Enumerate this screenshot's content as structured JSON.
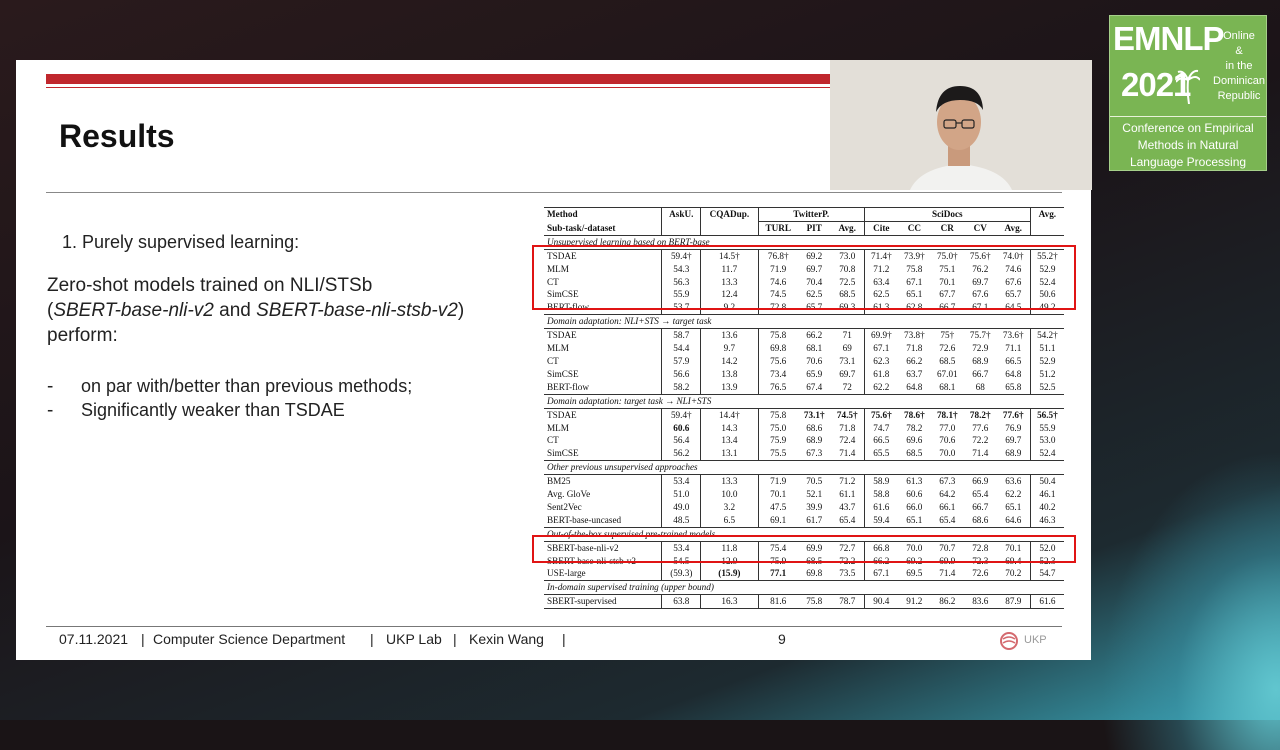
{
  "slide": {
    "title": "Results",
    "point_heading": "1. Purely supervised learning:",
    "line1": "Zero-shot models trained on NLI/STSb",
    "line2_paren_open": "(",
    "line2_model1": "SBERT-base-nli-v2",
    "line2_and": " and ",
    "line2_model2": "SBERT-base-nli-stsb-v2",
    "line2_paren_close": ")",
    "line3": "perform:",
    "bullets": [
      {
        "dash": "-",
        "text": "on par with/better than previous methods;"
      },
      {
        "dash": "-",
        "text": "Significantly weaker than TSDAE"
      }
    ],
    "footer": {
      "date": "07.11.2021",
      "sep": "|",
      "department": "Computer Science Department",
      "lab": "UKP Lab",
      "author": "Kexin Wang",
      "page": "9",
      "logo": "UKP"
    }
  },
  "table": {
    "head1": [
      "Method",
      "AskU.",
      "CQADup.",
      "TwitterP.",
      "SciDocs",
      "Avg."
    ],
    "head2": [
      "Sub-task/-dataset",
      "TURL",
      "PIT",
      "Avg.",
      "Cite",
      "CC",
      "CR",
      "CV",
      "Avg."
    ],
    "sections": [
      {
        "title": "Unsupervised learning based on BERT-base",
        "rows": [
          [
            "TSDAE",
            "59.4†",
            "14.5†",
            "76.8†",
            "69.2",
            "73.0",
            "71.4†",
            "73.9†",
            "75.0†",
            "75.6†",
            "74.0†",
            "55.2†"
          ],
          [
            "MLM",
            "54.3",
            "11.7",
            "71.9",
            "69.7",
            "70.8",
            "71.2",
            "75.8",
            "75.1",
            "76.2",
            "74.6",
            "52.9"
          ],
          [
            "CT",
            "56.3",
            "13.3",
            "74.6",
            "70.4",
            "72.5",
            "63.4",
            "67.1",
            "70.1",
            "69.7",
            "67.6",
            "52.4"
          ],
          [
            "SimCSE",
            "55.9",
            "12.4",
            "74.5",
            "62.5",
            "68.5",
            "62.5",
            "65.1",
            "67.7",
            "67.6",
            "65.7",
            "50.6"
          ],
          [
            "BERT-flow",
            "53.7",
            "9.2",
            "72.8",
            "65.7",
            "69.3",
            "61.3",
            "62.8",
            "66.7",
            "67.1",
            "64.5",
            "49.2"
          ]
        ]
      },
      {
        "title": "Domain adaptation: NLI+STS → target task",
        "rows": [
          [
            "TSDAE",
            "58.7",
            "13.6",
            "75.8",
            "66.2",
            "71",
            "69.9†",
            "73.8†",
            "75†",
            "75.7†",
            "73.6†",
            "54.2†"
          ],
          [
            "MLM",
            "54.4",
            "9.7",
            "69.8",
            "68.1",
            "69",
            "67.1",
            "71.8",
            "72.6",
            "72.9",
            "71.1",
            "51.1"
          ],
          [
            "CT",
            "57.9",
            "14.2",
            "75.6",
            "70.6",
            "73.1",
            "62.3",
            "66.2",
            "68.5",
            "68.9",
            "66.5",
            "52.9"
          ],
          [
            "SimCSE",
            "56.6",
            "13.8",
            "73.4",
            "65.9",
            "69.7",
            "61.8",
            "63.7",
            "67.01",
            "66.7",
            "64.8",
            "51.2"
          ],
          [
            "BERT-flow",
            "58.2",
            "13.9",
            "76.5",
            "67.4",
            "72",
            "62.2",
            "64.8",
            "68.1",
            "68",
            "65.8",
            "52.5"
          ]
        ]
      },
      {
        "title": "Domain adaptation: target task → NLI+STS",
        "rows": [
          [
            "TSDAE",
            "59.4†",
            "14.4†",
            "75.8",
            "73.1†",
            "74.5†",
            "75.6†",
            "78.6†",
            "78.1†",
            "78.2†",
            "77.6†",
            "56.5†"
          ],
          [
            "MLM",
            "60.6",
            "14.3",
            "75.0",
            "68.6",
            "71.8",
            "74.7",
            "78.2",
            "77.0",
            "77.6",
            "76.9",
            "55.9"
          ],
          [
            "CT",
            "56.4",
            "13.4",
            "75.9",
            "68.9",
            "72.4",
            "66.5",
            "69.6",
            "70.6",
            "72.2",
            "69.7",
            "53.0"
          ],
          [
            "SimCSE",
            "56.2",
            "13.1",
            "75.5",
            "67.3",
            "71.4",
            "65.5",
            "68.5",
            "70.0",
            "71.4",
            "68.9",
            "52.4"
          ]
        ]
      },
      {
        "title": "Other previous unsupervised approaches",
        "rows": [
          [
            "BM25",
            "53.4",
            "13.3",
            "71.9",
            "70.5",
            "71.2",
            "58.9",
            "61.3",
            "67.3",
            "66.9",
            "63.6",
            "50.4"
          ],
          [
            "Avg. GloVe",
            "51.0",
            "10.0",
            "70.1",
            "52.1",
            "61.1",
            "58.8",
            "60.6",
            "64.2",
            "65.4",
            "62.2",
            "46.1"
          ],
          [
            "Sent2Vec",
            "49.0",
            "3.2",
            "47.5",
            "39.9",
            "43.7",
            "61.6",
            "66.0",
            "66.1",
            "66.7",
            "65.1",
            "40.2"
          ],
          [
            "BERT-base-uncased",
            "48.5",
            "6.5",
            "69.1",
            "61.7",
            "65.4",
            "59.4",
            "65.1",
            "65.4",
            "68.6",
            "64.6",
            "46.3"
          ]
        ]
      },
      {
        "title": "Out-of-the-box supervised pre-trained models",
        "rows": [
          [
            "SBERT-base-nli-v2",
            "53.4",
            "11.8",
            "75.4",
            "69.9",
            "72.7",
            "66.8",
            "70.0",
            "70.7",
            "72.8",
            "70.1",
            "52.0"
          ],
          [
            "SBERT-base-nli-stsb-v2",
            "54.5",
            "12.9",
            "75.9",
            "68.5",
            "72.2",
            "66.2",
            "69.2",
            "69.9",
            "72.3",
            "69.4",
            "52.3"
          ],
          [
            "USE-large",
            "(59.3)",
            "(15.9)",
            "77.1",
            "69.8",
            "73.5",
            "67.1",
            "69.5",
            "71.4",
            "72.6",
            "70.2",
            "54.7"
          ]
        ]
      },
      {
        "title": "In-domain supervised training (upper bound)",
        "rows": [
          [
            "SBERT-supervised",
            "63.8",
            "16.3",
            "81.6",
            "75.8",
            "78.7",
            "90.4",
            "91.2",
            "86.2",
            "83.6",
            "87.9",
            "61.6"
          ]
        ]
      }
    ]
  },
  "badge": {
    "name": "EMNLP",
    "year": "2021",
    "location_lines": [
      "Online",
      "&",
      "in the",
      "Dominican",
      "Republic"
    ],
    "subtitle_lines": [
      "Conference on Empirical",
      "Methods in Natural",
      "Language Processing"
    ],
    "bg_color": "#7ab553"
  },
  "colors": {
    "accent_red": "#c0272d",
    "highlight_box": "#e01414"
  },
  "webcam": {
    "content": "presenter video"
  }
}
